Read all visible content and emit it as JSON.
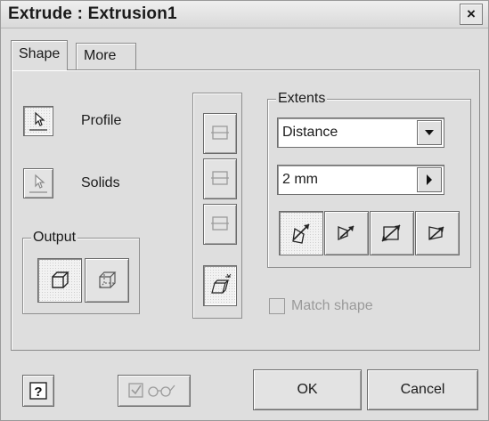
{
  "window": {
    "title": "Extrude : Extrusion1",
    "close_label": "×"
  },
  "tabs": [
    {
      "label": "Shape",
      "active": true
    },
    {
      "label": "More",
      "active": false
    }
  ],
  "selection": {
    "profile_label": "Profile",
    "solids_label": "Solids"
  },
  "output": {
    "group_label": "Output"
  },
  "extents": {
    "group_label": "Extents",
    "type_value": "Distance",
    "distance_value": "2 mm",
    "match_shape_label": "Match shape"
  },
  "footer": {
    "help_label": "?",
    "ok_label": "OK",
    "cancel_label": "Cancel"
  }
}
